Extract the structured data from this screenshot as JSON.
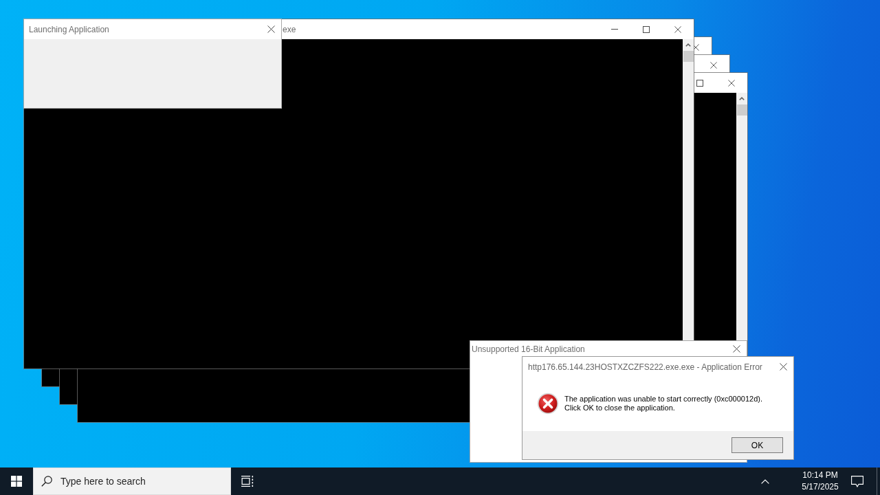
{
  "console_window": {
    "title": "exe"
  },
  "launching_window": {
    "title": "Launching Application"
  },
  "unsupported_dialog": {
    "title": "Unsupported 16-Bit Application"
  },
  "error_dialog": {
    "title": "http176.65.144.23HOSTXZCZFS222.exe.exe - Application Error",
    "message": "The application was unable to start correctly (0xc000012d).\nClick OK to close the application.",
    "buttons": [
      "OK"
    ]
  },
  "taskbar": {
    "search": {
      "placeholder": "Type here to search"
    },
    "clock": {
      "time": "10:14 PM",
      "date": "5/17/2025"
    }
  }
}
